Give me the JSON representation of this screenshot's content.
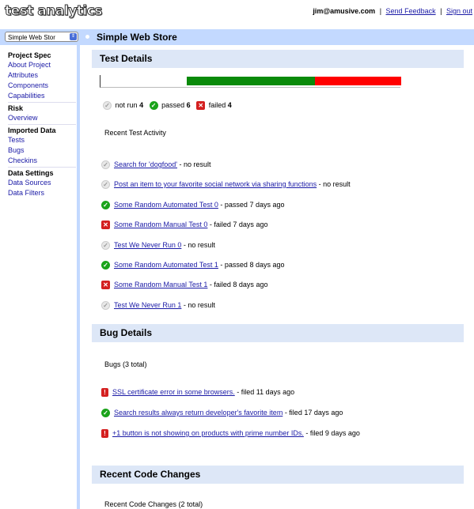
{
  "app": {
    "logo": "test analytics"
  },
  "user": {
    "email": "jim@amusive.com",
    "feedback": "Send Feedback",
    "signout": "Sign out",
    "sep": "|"
  },
  "project": {
    "selected": "Simple Web Stor",
    "title": "Simple Web Store"
  },
  "sidebar": {
    "groups": [
      {
        "heading": "Project Spec",
        "items": [
          "About Project",
          "Attributes",
          "Components",
          "Capabilities"
        ]
      },
      {
        "heading": "Risk",
        "items": [
          "Overview"
        ]
      },
      {
        "heading": "Imported Data",
        "items": [
          "Tests",
          "Bugs",
          "Checkins"
        ]
      },
      {
        "heading": "Data Settings",
        "items": [
          "Data Sources",
          "Data Filters"
        ]
      }
    ]
  },
  "test_details": {
    "title": "Test Details",
    "progress": {
      "not_run": 4,
      "passed": 6,
      "failed": 4
    },
    "summary": {
      "not_run_label": "not run",
      "not_run": "4",
      "passed_label": "passed",
      "passed": "6",
      "failed_label": "failed",
      "failed": "4"
    },
    "activity_title": "Recent Test Activity",
    "tests": [
      {
        "status": "notrun",
        "name": "Search for 'dogfood'",
        "detail": " - no result"
      },
      {
        "status": "notrun",
        "name": "Post an item to your favorite social network via sharing functions",
        "detail": " - no result"
      },
      {
        "status": "pass",
        "name": "Some Random Automated Test 0",
        "detail": " - passed 7 days ago"
      },
      {
        "status": "fail",
        "name": "Some Random Manual Test 0",
        "detail": " - failed 7 days ago"
      },
      {
        "status": "notrun",
        "name": "Test We Never Run 0",
        "detail": " - no result"
      },
      {
        "status": "pass",
        "name": "Some Random Automated Test 1",
        "detail": " - passed 8 days ago"
      },
      {
        "status": "fail",
        "name": "Some Random Manual Test 1",
        "detail": " - failed 8 days ago"
      },
      {
        "status": "notrun",
        "name": "Test We Never Run 1",
        "detail": " - no result"
      }
    ]
  },
  "bug_details": {
    "title": "Bug Details",
    "count_label": "Bugs (3 total)",
    "bugs": [
      {
        "status": "bug",
        "name": "SSL certificate error in some browsers.",
        "detail": " - filed 11 days ago"
      },
      {
        "status": "pass",
        "name": "Search results always return developer's favorite item",
        "detail": " - filed 17 days ago"
      },
      {
        "status": "bug",
        "name": "+1 button is not showing on products with prime number IDs.",
        "detail": " - filed 9 days ago"
      }
    ]
  },
  "code_changes": {
    "title": "Recent Code Changes",
    "count_label": "Recent Code Changes (2 total)"
  },
  "colors": {
    "passed": "#0a8a0a",
    "failed": "#ff0000",
    "header_bg": "#dde7f7",
    "project_bar": "#c3d9ff"
  },
  "icons": {
    "notrun": "check-grey-icon",
    "pass": "check-green-icon",
    "fail": "x-red-icon",
    "bug": "exclamation-red-icon"
  }
}
